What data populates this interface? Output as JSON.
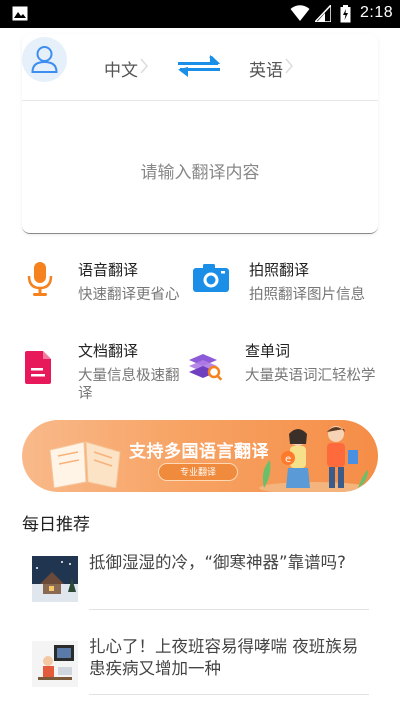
{
  "status_bar": {
    "time": "2:18",
    "icons": [
      "image-icon",
      "wifi-icon",
      "signal-icon",
      "battery-charging-icon"
    ]
  },
  "translator": {
    "source_language": "中文",
    "target_language": "英语",
    "input_placeholder": "请输入翻译内容",
    "icons": [
      "user-avatar-icon",
      "swap-arrows-icon",
      "chevron-right-icon"
    ]
  },
  "features": [
    {
      "title": "语音翻译",
      "desc": "快速翻译更省心",
      "icon": "microphone-icon",
      "color": "#f5821f"
    },
    {
      "title": "拍照翻译",
      "desc": "拍照翻译图片信息",
      "icon": "camera-icon",
      "color": "#1b8fe8"
    },
    {
      "title": "文档翻译",
      "desc": "大量信息极速翻译",
      "icon": "document-icon",
      "color": "#e8195a"
    },
    {
      "title": "查单词",
      "desc": "大量英语词汇轻松学",
      "icon": "book-search-icon",
      "color": "#8e5bd8"
    }
  ],
  "banner": {
    "title": "支持多国语言翻译",
    "button_label": "专业翻译",
    "color": "#f7a364"
  },
  "daily": {
    "section_title": "每日推荐",
    "articles": [
      {
        "title": "抵御湿湿的冷，“御寒神器”靠谱吗?"
      },
      {
        "title": "扎心了！上夜班容易得哮喘 夜班族易患疾病又增加一种"
      }
    ]
  },
  "colors": {
    "accent_blue": "#1b8fe8",
    "status_bar": "#000000"
  }
}
